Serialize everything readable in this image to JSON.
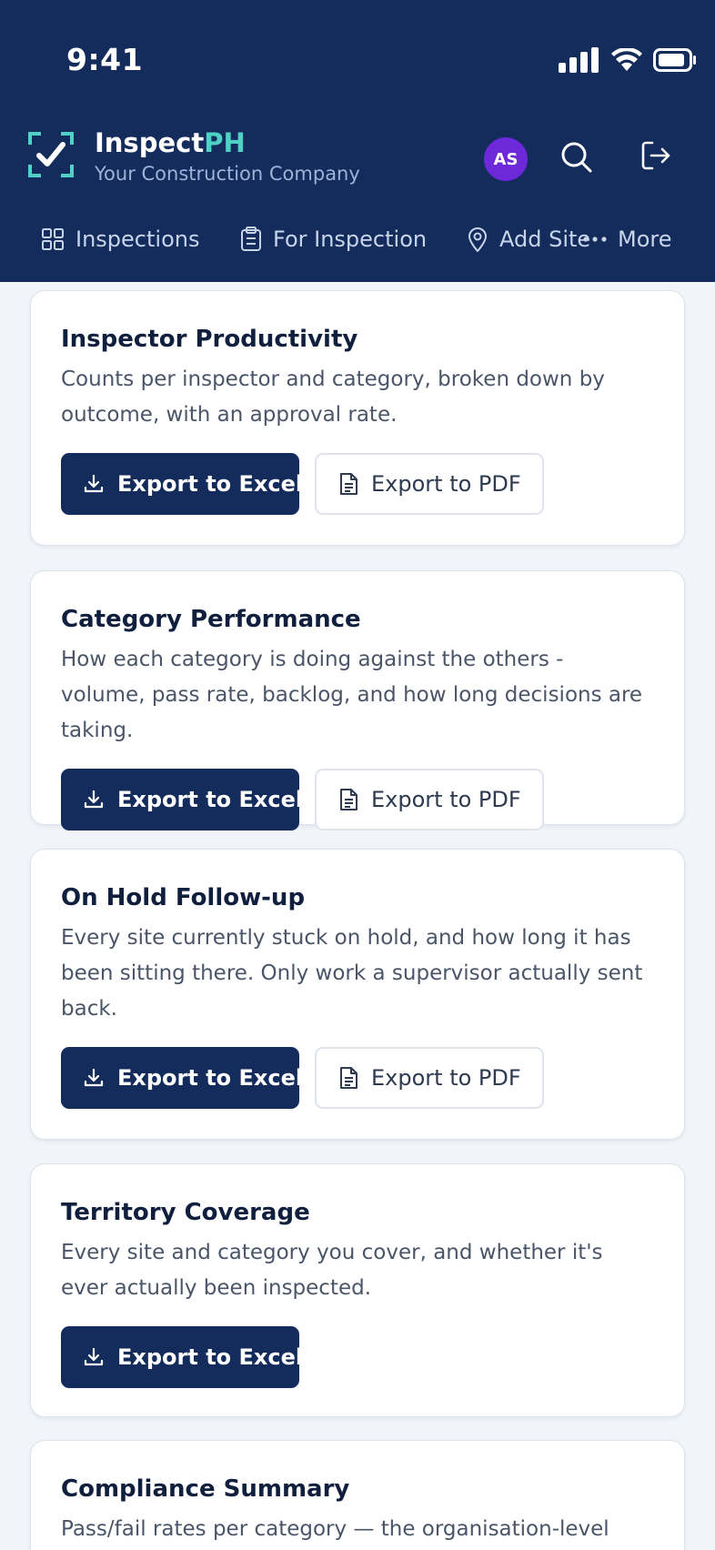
{
  "status_bar": {
    "time": "9:41"
  },
  "app": {
    "name_main": "Inspect",
    "name_accent": "PH",
    "subtitle": "Your Construction Company",
    "avatar_initials": "AS"
  },
  "nav": {
    "items": [
      {
        "label": "Inspections",
        "icon": "grid-icon"
      },
      {
        "label": "For Inspection",
        "icon": "clipboard-icon"
      },
      {
        "label": "Add Site",
        "icon": "map-pin-icon"
      },
      {
        "label": "More",
        "icon": "more-dots-icon"
      }
    ]
  },
  "reports": [
    {
      "title": "Inspector Productivity",
      "description": "Counts per inspector and category, broken down by outcome, with an approval rate.",
      "excel_label": "Export to Excel",
      "pdf_label": "Export to PDF"
    },
    {
      "title": "Category Performance",
      "description": "How each category is doing against the others - volume, pass rate, backlog, and how long decisions are taking.",
      "excel_label": "Export to Excel",
      "pdf_label": "Export to PDF"
    },
    {
      "title": "On Hold Follow-up",
      "description": "Every site currently stuck on hold, and how long it has been sitting there. Only work a supervisor actually sent back.",
      "excel_label": "Export to Excel",
      "pdf_label": "Export to PDF"
    },
    {
      "title": "Territory Coverage",
      "description": "Every site and category you cover, and whether it's ever actually been inspected.",
      "excel_label": "Export to Excel"
    },
    {
      "title": "Compliance Summary",
      "description": "Pass/fail rates per category — the organisation-level"
    }
  ],
  "colors": {
    "header_bg": "#132c5c",
    "accent": "#4fd1c5",
    "avatar_bg": "#6d28d9",
    "primary_button": "#132c5c"
  }
}
